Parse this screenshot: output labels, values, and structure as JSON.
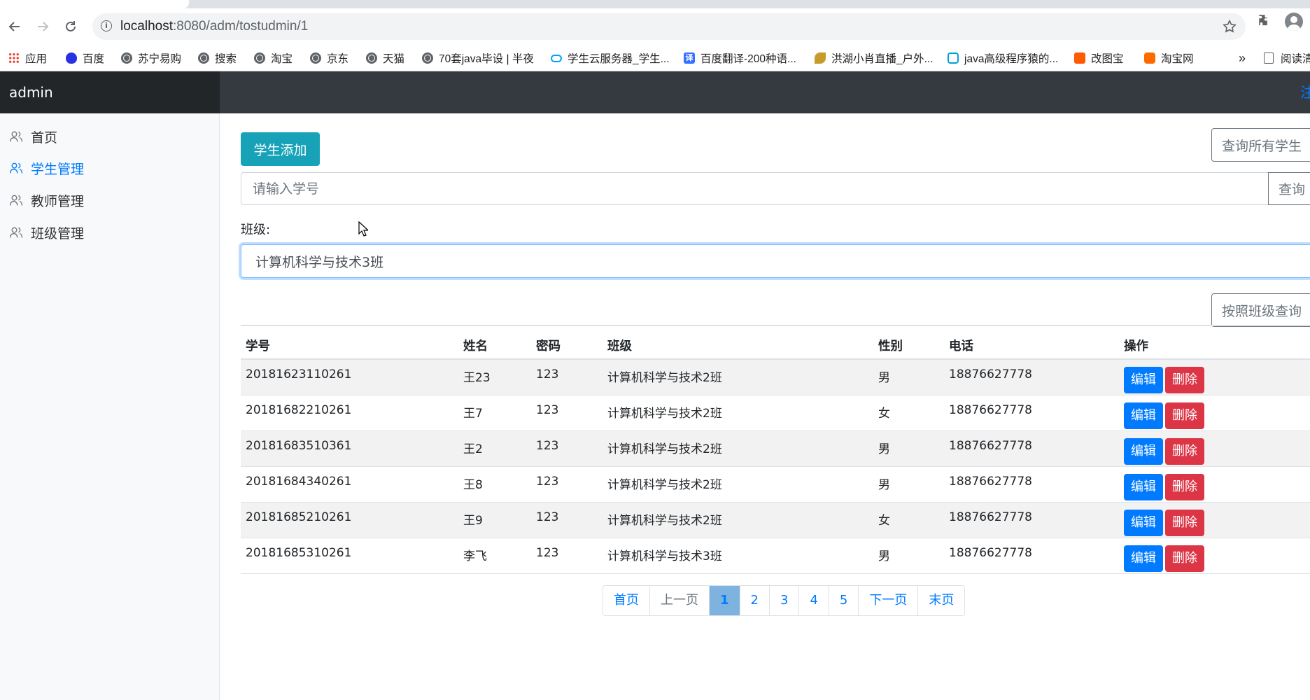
{
  "browser": {
    "url_host": "localhost",
    "url_rest": ":8080/adm/tostudmin/1",
    "bookmarks": [
      {
        "label": "应用",
        "icon": "apps-grid-icon"
      },
      {
        "label": "百度",
        "icon": "baidu-icon"
      },
      {
        "label": "苏宁易购",
        "icon": "globe-icon"
      },
      {
        "label": "搜索",
        "icon": "globe-icon"
      },
      {
        "label": "淘宝",
        "icon": "globe-icon"
      },
      {
        "label": "京东",
        "icon": "globe-icon"
      },
      {
        "label": "天猫",
        "icon": "globe-icon"
      },
      {
        "label": "70套java毕设 | 半夜",
        "icon": "globe-icon"
      },
      {
        "label": "学生云服务器_学生...",
        "icon": "cloud-icon"
      },
      {
        "label": "百度翻译-200种语...",
        "icon": "translate-icon"
      },
      {
        "label": "洪湖小肖直播_户外...",
        "icon": "leaf-icon"
      },
      {
        "label": "java高级程序猿的...",
        "icon": "bilibili-icon"
      },
      {
        "label": "改图宝",
        "icon": "image-edit-icon"
      },
      {
        "label": "淘宝网",
        "icon": "taobao-icon"
      }
    ],
    "more": "»",
    "reading_list": "阅读清"
  },
  "app": {
    "brand": "admin",
    "nav_right": "注"
  },
  "sidebar": {
    "items": [
      {
        "label": "首页",
        "active": false
      },
      {
        "label": "学生管理",
        "active": true
      },
      {
        "label": "教师管理",
        "active": false
      },
      {
        "label": "班级管理",
        "active": false
      }
    ]
  },
  "main": {
    "add_button": "学生添加",
    "query_all_button": "查询所有学生",
    "search_placeholder": "请输入学号",
    "search_value": "",
    "search_button": "查询",
    "class_label": "班级:",
    "class_selected": "计算机科学与技术3班",
    "class_query_button": "按照班级查询"
  },
  "table": {
    "headers": [
      "学号",
      "姓名",
      "密码",
      "班级",
      "性别",
      "电话",
      "操作"
    ],
    "rows": [
      [
        "20181623110261",
        "王23",
        "123",
        "计算机科学与技术2班",
        "男",
        "18876627778"
      ],
      [
        "20181682210261",
        "王7",
        "123",
        "计算机科学与技术2班",
        "女",
        "18876627778"
      ],
      [
        "20181683510361",
        "王2",
        "123",
        "计算机科学与技术2班",
        "男",
        "18876627778"
      ],
      [
        "20181684340261",
        "王8",
        "123",
        "计算机科学与技术2班",
        "男",
        "18876627778"
      ],
      [
        "20181685210261",
        "王9",
        "123",
        "计算机科学与技术2班",
        "女",
        "18876627778"
      ],
      [
        "20181685310261",
        "李飞",
        "123",
        "计算机科学与技术3班",
        "男",
        "18876627778"
      ]
    ],
    "edit_label": "编辑",
    "delete_label": "删除"
  },
  "pagination": {
    "first": "首页",
    "prev": "上一页",
    "pages": [
      "1",
      "2",
      "3",
      "4",
      "5"
    ],
    "current": "1",
    "next": "下一页",
    "last": "末页"
  },
  "colors": {
    "accent": "#007bff",
    "info": "#17a2b8",
    "danger": "#dc3545",
    "navbar": "#343a40"
  }
}
